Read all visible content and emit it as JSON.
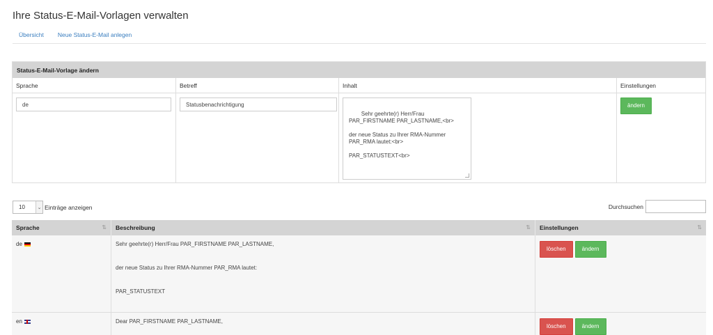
{
  "page": {
    "title": "Ihre Status-E-Mail-Vorlagen verwalten"
  },
  "nav": {
    "overview": "Übersicht",
    "new": "Neue Status-E-Mail anlegen"
  },
  "edit_form": {
    "heading": "Status-E-Mail-Vorlage ändern",
    "columns": {
      "language": "Sprache",
      "subject": "Betreff",
      "content": "Inhalt",
      "settings": "Einstellungen"
    },
    "language_value": "de",
    "subject_value": "Statusbenachrichtigung",
    "content_value": "Sehr geehrte(r) Herr/Frau\nPAR_FIRSTNAME PAR_LASTNAME,<br>\n\nder neue Status zu Ihrer RMA-Nummer\nPAR_RMA lautet:<br>\n\nPAR_STATUSTEXT<br>",
    "save_button": "ändern"
  },
  "table_controls": {
    "length_value": "10",
    "length_label": "Einträge anzeigen",
    "search_label": "Durchsuchen"
  },
  "table": {
    "headers": {
      "language": "Sprache",
      "description": "Beschreibung",
      "settings": "Einstellungen"
    },
    "rows": [
      {
        "language": "de",
        "flag": "flag-de-icon",
        "lines": [
          "Sehr geehrte(r) Herr/Frau PAR_FIRSTNAME PAR_LASTNAME,",
          "der neue Status zu Ihrer RMA-Nummer PAR_RMA lautet:",
          "PAR_STATUSTEXT"
        ],
        "delete_label": "löschen",
        "edit_label": "ändern"
      },
      {
        "language": "en",
        "flag": "flag-uk-icon",
        "lines": [
          "Dear PAR_FIRSTNAME PAR_LASTNAME,"
        ],
        "delete_label": "löschen",
        "edit_label": "ändern"
      }
    ]
  },
  "colors": {
    "accent_link": "#3a7ebf",
    "button_green": "#5cb85c",
    "button_red": "#d9534f",
    "header_gray": "#d4d4d4"
  }
}
